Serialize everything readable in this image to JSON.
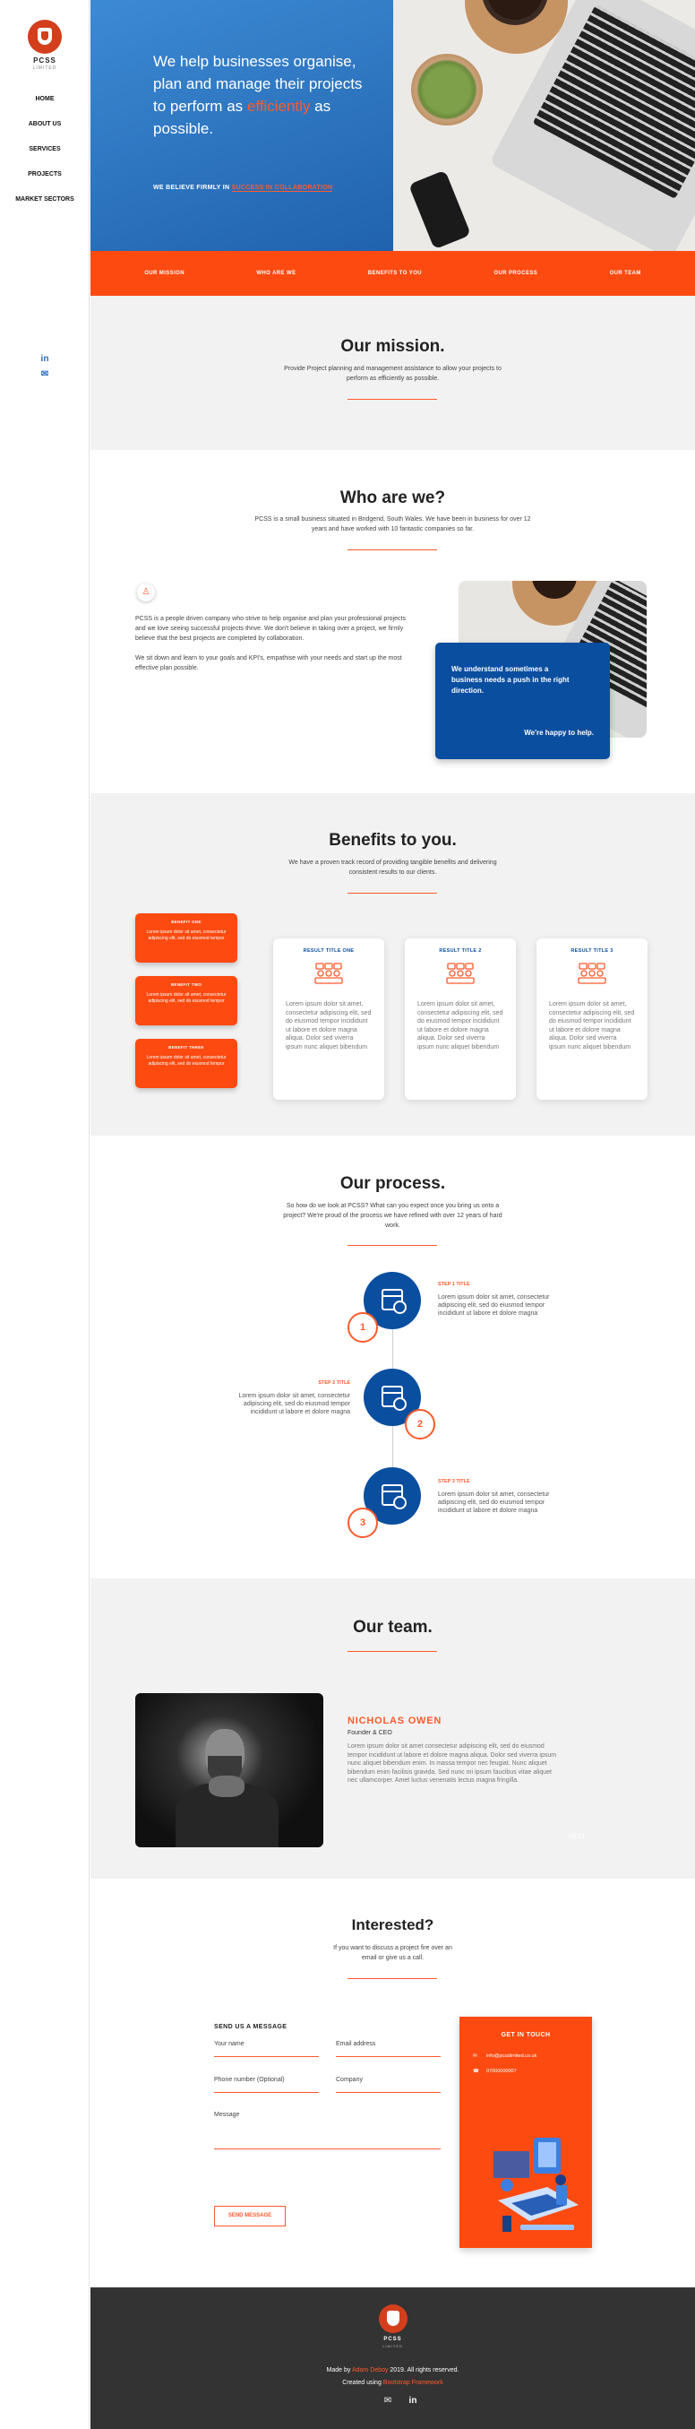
{
  "brand": {
    "name": "PCSS",
    "sub": "LIMITED"
  },
  "nav": [
    "HOME",
    "ABOUT US",
    "SERVICES",
    "PROJECTS",
    "MARKET SECTORS"
  ],
  "hero": {
    "title_a": "We help businesses organise, plan and manage their projects to perform as ",
    "title_hl": "efficiently",
    "title_b": " as possible.",
    "sub_a": "WE BELIEVE FIRMLY IN ",
    "sub_hl": "SUCCESS IN COLLABORATION"
  },
  "tabs": [
    "OUR MISSION",
    "WHO ARE WE",
    "BENEFITS TO YOU",
    "OUR PROCESS",
    "OUR TEAM"
  ],
  "mission": {
    "title": "Our mission.",
    "text": "Provide Project planning and management assistance to allow your projects to perform as efficiently as possible."
  },
  "who": {
    "title": "Who are we?",
    "text": "PCSS is a small business situated in Bridgend, South Wales. We have been in business for over 12 years and have worked with 10 fantastic companies so far.",
    "body1": "PCSS is a people driven company who strive to help organise and plan your professional projects and we love seeing successful projects thrive. We don't believe in taking over a project, we firmly believe that the best projects are completed by collaboration.",
    "body2": "We sit down and learn to your goals and KPI's, empathise with your needs and start up the most effective plan possible.",
    "card_text": "We understand sometimes a business needs a push in the right direction.",
    "card_tag": "We're happy to help."
  },
  "benefits": {
    "title": "Benefits to you.",
    "text": "We have a proven track record of providing tangible benefits and delivering consistent results to our clients.",
    "items": [
      {
        "title": "BENEFIT ONE",
        "text": "Lorem ipsum dolor sit amet, consectetur adipiscing elit, sed do eiusmod tempor"
      },
      {
        "title": "BENEFIT TWO",
        "text": "Lorem ipsum dolor sit amet, consectetur adipiscing elit, sed do eiusmod tempor"
      },
      {
        "title": "BENEFIT THREE",
        "text": "Lorem ipsum dolor sit amet, consectetur adipiscing elit, sed do eiusmod tempor"
      }
    ],
    "results": [
      {
        "title": "RESULT TITLE ONE",
        "text": "Lorem ipsum dolor sit amet, consectetur adipiscing elit, sed do eiusmod tempor incididunt ut labore et dolore magna aliqua. Dolor sed viverra ipsum nunc aliquet bibendum"
      },
      {
        "title": "RESULT TITLE 2",
        "text": "Lorem ipsum dolor sit amet, consectetur adipiscing elit, sed do eiusmod tempor incididunt ut labore et dolore magna aliqua. Dolor sed viverra ipsum nunc aliquet bibendum"
      },
      {
        "title": "RESULT TITLE 3",
        "text": "Lorem ipsum dolor sit amet, consectetur adipiscing elit, sed do eiusmod tempor incididunt ut labore et dolore magna aliqua. Dolor sed viverra ipsum nunc aliquet bibendum"
      }
    ]
  },
  "process": {
    "title": "Our process.",
    "text": "So how do we look at PCSS? What can you expect once you bring us onto a project? We're proud of the process we have refined with over 12 years of hard work.",
    "steps": [
      {
        "num": "1",
        "title": "STEP 1 TITLE",
        "text": "Lorem ipsum dolor sit amet, consectetur adipiscing elit, sed do eiusmod tempor incididunt ut labore et dolore magna"
      },
      {
        "num": "2",
        "title": "STEP 2 TITLE",
        "text": "Lorem ipsum dolor sit amet, consectetur adipiscing elit, sed do eiusmod tempor incididunt ut labore et dolore magna"
      },
      {
        "num": "3",
        "title": "STEP 3 TITLE",
        "text": "Lorem ipsum dolor sit amet, consectetur adipiscing elit, sed do eiusmod tempor incididunt ut labore et dolore magna"
      }
    ]
  },
  "team": {
    "title": "Our team.",
    "name": "NICHOLAS OWEN",
    "role": "Founder & CEO",
    "bio": "Lorem ipsum dolor sit amet consectetur adipiscing elit, sed do eiusmod tempor incididunt ut labore et dolore magna aliqua. Dolor sed viverra ipsum nunc aliquet bibendum enim. In massa tempor nec feugiat. Nunc aliquet bibendum enim facilisis gravida. Sed nunc mi ipsum faucibus vitae aliquet nec ullamcorper. Amet luctus venenatis lectus magna fringilla.",
    "next": "NEXT"
  },
  "contact": {
    "title": "Interested?",
    "text": "If you want to discuss a project fire over an email or give us a call.",
    "form_title": "SEND US A MESSAGE",
    "fields": [
      "Your name",
      "Email address",
      "Phone number (Optional)",
      "Company",
      "Message"
    ],
    "send": "SEND MESSAGE",
    "get_title": "GET IN TOUCH",
    "email": "info@pcsslimited.co.uk",
    "phone": "07000000007"
  },
  "footer": {
    "made_a": "Made by ",
    "made_hl": "Adam Deboy",
    "made_b": " 2019. All rights reserved.",
    "created_a": "Created using ",
    "created_hl": "Bootstrap Framework"
  },
  "colors": {
    "accent": "#fd4a11",
    "primary": "#0a4ea0",
    "dark": "#333333"
  }
}
